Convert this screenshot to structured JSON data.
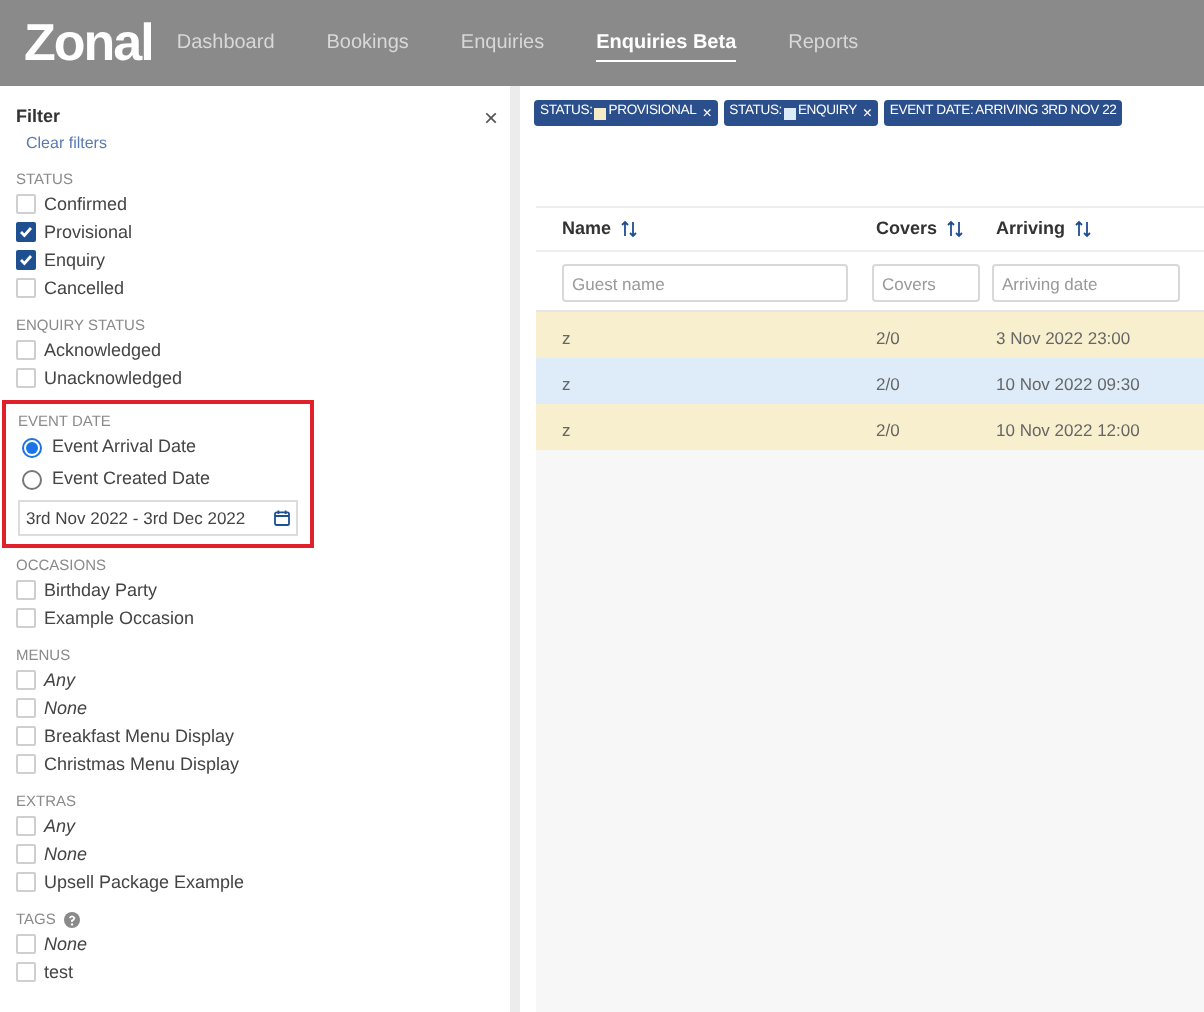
{
  "header": {
    "logo": "Zonal",
    "nav": [
      {
        "label": "Dashboard",
        "selected": false
      },
      {
        "label": "Bookings",
        "selected": false
      },
      {
        "label": "Enquiries",
        "selected": false
      },
      {
        "label": "Enquiries Beta",
        "selected": true
      },
      {
        "label": "Reports",
        "selected": false
      }
    ]
  },
  "filter": {
    "title": "Filter",
    "clear": "Clear filters",
    "close": "×",
    "sections": [
      {
        "heading": "STATUS",
        "kind": "checkbox",
        "highlighted": false,
        "items": [
          {
            "label": "Confirmed",
            "checked": false,
            "italic": false
          },
          {
            "label": "Provisional",
            "checked": true,
            "italic": false
          },
          {
            "label": "Enquiry",
            "checked": true,
            "italic": false
          },
          {
            "label": "Cancelled",
            "checked": false,
            "italic": false
          }
        ]
      },
      {
        "heading": "ENQUIRY STATUS",
        "kind": "checkbox",
        "highlighted": false,
        "items": [
          {
            "label": "Acknowledged",
            "checked": false,
            "italic": false
          },
          {
            "label": "Unacknowledged",
            "checked": false,
            "italic": false
          }
        ]
      },
      {
        "heading": "EVENT DATE",
        "kind": "radio",
        "highlighted": true,
        "items": [
          {
            "label": "Event Arrival Date",
            "selected": true
          },
          {
            "label": "Event Created Date",
            "selected": false
          }
        ],
        "date_range": "3rd Nov 2022 - 3rd Dec 2022"
      },
      {
        "heading": "OCCASIONS",
        "kind": "checkbox",
        "highlighted": false,
        "items": [
          {
            "label": "Birthday Party",
            "checked": false,
            "italic": false
          },
          {
            "label": "Example Occasion",
            "checked": false,
            "italic": false
          }
        ]
      },
      {
        "heading": "MENUS",
        "kind": "checkbox",
        "highlighted": false,
        "items": [
          {
            "label": "Any",
            "checked": false,
            "italic": true
          },
          {
            "label": "None",
            "checked": false,
            "italic": true
          },
          {
            "label": "Breakfast Menu Display",
            "checked": false,
            "italic": false
          },
          {
            "label": "Christmas Menu Display",
            "checked": false,
            "italic": false
          }
        ]
      },
      {
        "heading": "EXTRAS",
        "kind": "checkbox",
        "highlighted": false,
        "items": [
          {
            "label": "Any",
            "checked": false,
            "italic": true
          },
          {
            "label": "None",
            "checked": false,
            "italic": true
          },
          {
            "label": "Upsell Package Example",
            "checked": false,
            "italic": false
          }
        ]
      },
      {
        "heading": "TAGS",
        "kind": "checkbox",
        "highlighted": false,
        "help": true,
        "items": [
          {
            "label": "None",
            "checked": false,
            "italic": true
          },
          {
            "label": "test",
            "checked": false,
            "italic": false
          }
        ]
      }
    ]
  },
  "chips": [
    {
      "prefix": "STATUS:",
      "value": "PROVISIONAL",
      "color": "#f5ecc7",
      "remove": "×"
    },
    {
      "prefix": "STATUS:",
      "value": "ENQUIRY",
      "color": "#dcebf8",
      "remove": "×"
    },
    {
      "prefix": "EVENT DATE:",
      "value": "ARRIVING 3RD NOV 22"
    }
  ],
  "table": {
    "columns": [
      {
        "label": "Name",
        "placeholder": "Guest name"
      },
      {
        "label": "Covers",
        "placeholder": "Covers"
      },
      {
        "label": "Arriving",
        "placeholder": "Arriving date"
      }
    ],
    "rows": [
      {
        "color": "#f7efcd",
        "cells": [
          "z",
          "2/0",
          "3 Nov 2022 23:00"
        ]
      },
      {
        "color": "#deecf9",
        "cells": [
          "z",
          "2/0",
          "10 Nov 2022 09:30"
        ]
      },
      {
        "color": "#f7efcd",
        "cells": [
          "z",
          "2/0",
          "10 Nov 2022 12:00"
        ]
      }
    ]
  }
}
